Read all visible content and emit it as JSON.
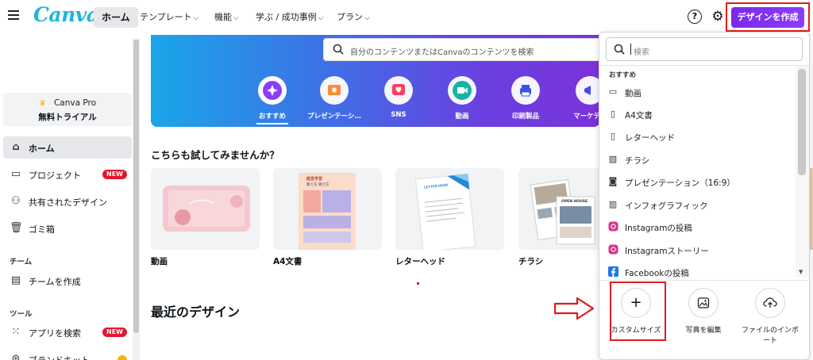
{
  "header": {
    "logo": "Canva",
    "nav": [
      {
        "label": "ホーム"
      },
      {
        "label": "テンプレート"
      },
      {
        "label": "機能"
      },
      {
        "label": "学ぶ / 成功事例"
      },
      {
        "label": "プラン"
      }
    ],
    "help_icon": "?",
    "create_button": "デザインを作成"
  },
  "sidebar": {
    "pro_title": "Canva Pro",
    "pro_subtitle": "無料トライアル",
    "items": [
      {
        "label": "ホーム",
        "icon": "home-icon"
      },
      {
        "label": "プロジェクト",
        "icon": "folder-icon",
        "badge": "NEW"
      },
      {
        "label": "共有されたデザイン",
        "icon": "shared-icon"
      },
      {
        "label": "ゴミ箱",
        "icon": "trash-icon"
      }
    ],
    "team_section": "チーム",
    "team_items": [
      {
        "label": "チームを作成",
        "icon": "team-icon"
      }
    ],
    "tools_section": "ツール",
    "tools_items": [
      {
        "label": "アプリを検索",
        "icon": "apps-icon",
        "badge": "NEW"
      },
      {
        "label": "ブランドキット",
        "icon": "brand-icon"
      }
    ]
  },
  "main": {
    "search_placeholder": "自分のコンテンツまたはCanvaのコンテンツを検索",
    "categories": [
      {
        "label": "おすすめ"
      },
      {
        "label": "プレゼンテーシ…"
      },
      {
        "label": "SNS"
      },
      {
        "label": "動画"
      },
      {
        "label": "印刷製品"
      },
      {
        "label": "マーケティ"
      }
    ],
    "suggest_title": "こちらも試してみませんか？",
    "cards": [
      {
        "label": "動画"
      },
      {
        "label": "A4文書"
      },
      {
        "label": "レターヘッド"
      },
      {
        "label": "チラシ"
      }
    ],
    "card_texts": {
      "a4_header": "経営学習",
      "a4_sub": "教え方 受け方",
      "letter_title": "LETTER HEAD",
      "flyer_title": "OPEN HOUSE"
    },
    "recent_title": "最近のデザイン"
  },
  "panel": {
    "search_placeholder": "検索",
    "section_label": "おすすめ",
    "items": [
      {
        "label": "動画",
        "icon": "video-icon"
      },
      {
        "label": "A4文書",
        "icon": "document-icon"
      },
      {
        "label": "レターヘッド",
        "icon": "letterhead-icon"
      },
      {
        "label": "チラシ",
        "icon": "flyer-icon"
      },
      {
        "label": "プレゼンテーション（16:9）",
        "icon": "presentation-icon"
      },
      {
        "label": "インフォグラフィック",
        "icon": "chart-icon"
      },
      {
        "label": "Instagramの投稿",
        "icon": "instagram-icon"
      },
      {
        "label": "Instagramストーリー",
        "icon": "instagram-icon"
      },
      {
        "label": "Facebookの投稿",
        "icon": "facebook-icon"
      }
    ],
    "actions": [
      {
        "label": "カスタムサイズ",
        "icon": "plus-icon"
      },
      {
        "label": "写真を編集",
        "icon": "image-icon"
      },
      {
        "label": "ファイルのインポート",
        "icon": "upload-icon"
      }
    ]
  },
  "colors": {
    "accent_purple": "#8b3dff",
    "canva_cyan": "#1fb5d6",
    "badge_red": "#e3162e",
    "annotation_red": "#e01b1b"
  }
}
